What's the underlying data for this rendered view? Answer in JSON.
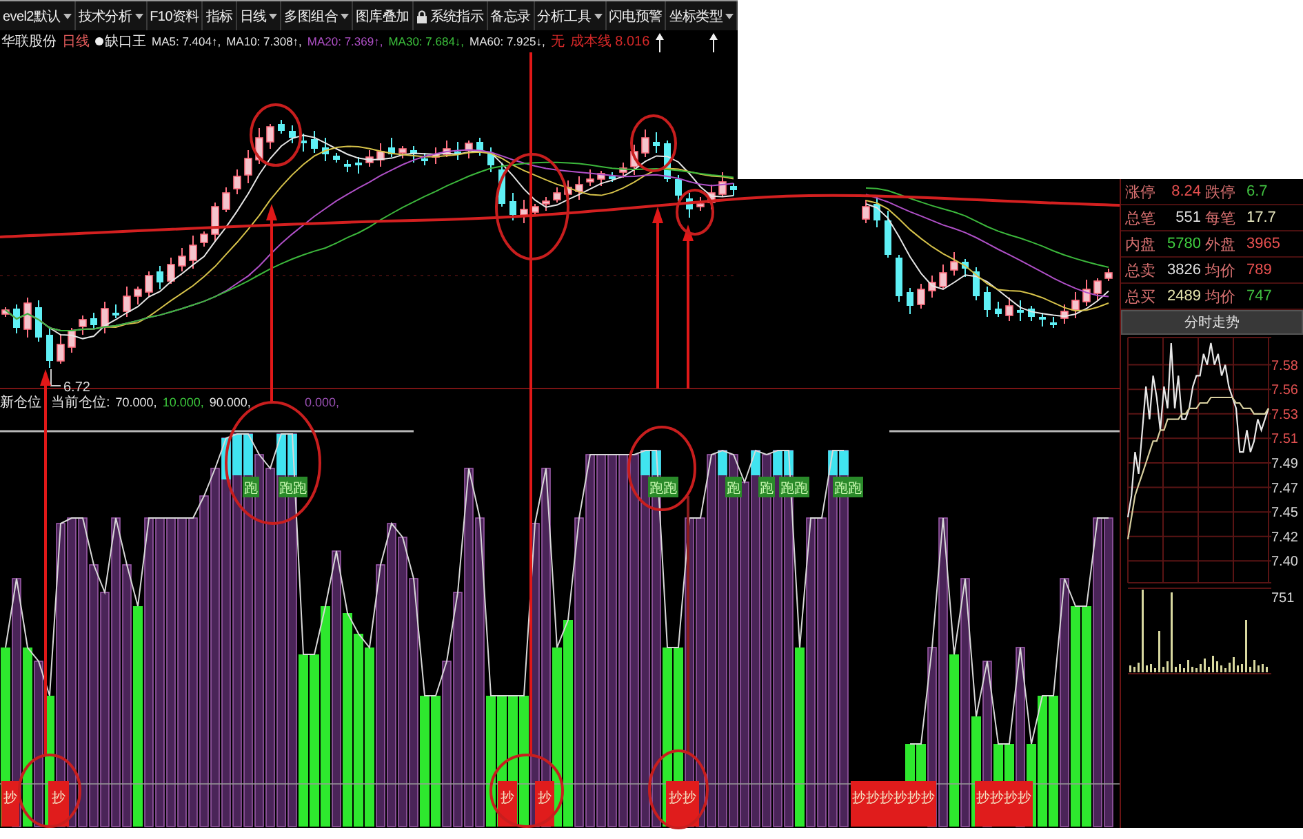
{
  "toolbar": {
    "items": [
      {
        "label": "evel2默认",
        "kind": "dropdown"
      },
      {
        "label": "技术分析",
        "kind": "dropdown"
      },
      {
        "label": "F10资料",
        "kind": "plain"
      },
      {
        "label": "指标",
        "kind": "plain"
      },
      {
        "label": "日线",
        "kind": "dropdown"
      },
      {
        "label": "多图组合",
        "kind": "dropdown"
      },
      {
        "label": "图库叠加",
        "kind": "plain"
      },
      {
        "label": "系统指示",
        "kind": "locked"
      },
      {
        "label": "备忘录",
        "kind": "plain"
      },
      {
        "label": "分析工具",
        "kind": "dropdown"
      },
      {
        "label": "闪电预警",
        "kind": "plain"
      },
      {
        "label": "坐标类型",
        "kind": "dropdown"
      }
    ]
  },
  "quote_line": {
    "stock": "华联股份",
    "period": "日线",
    "indicator": "缺口王",
    "values": [
      {
        "text": "MA5: 7.404↑,",
        "color": "#e6e6e6"
      },
      {
        "text": "MA10: 7.308↑,",
        "color": "#e6e6e6"
      },
      {
        "text": "MA20: 7.369↑,",
        "color": "#b050c8"
      },
      {
        "text": "MA30: 7.684↓,",
        "color": "#3cc03c"
      },
      {
        "text": "MA60: 7.925↓,",
        "color": "#e6e6e6"
      }
    ],
    "notes": [
      "无",
      "成本线 8.016"
    ]
  },
  "price_chart": {
    "low_label": "6.72"
  },
  "indicator": {
    "name": "新仓位",
    "label": "当前仓位:",
    "values": [
      {
        "text": "70.000,",
        "color": "#e6e6e6"
      },
      {
        "text": "10.000,",
        "color": "#3cc83c"
      },
      {
        "text": "90.000,",
        "color": "#e6e6e6"
      },
      {
        "text": "0.000,",
        "color": "#9a50b4"
      }
    ],
    "sell_tags": [
      "跑",
      "跑跑",
      "跑跑",
      "跑",
      "跑",
      "跑跑",
      "跑跑"
    ],
    "buy_tags": [
      "抄",
      "抄",
      "抄",
      "抄",
      "抄抄",
      "抄抄抄抄抄抄",
      "抄抄抄抄"
    ]
  },
  "quote_panel": {
    "rows": [
      {
        "label": "涨停",
        "value": {
          "text": "8.24",
          "color": "#e85050"
        },
        "label_2": "跌停",
        "value_2": {
          "text": "6.7",
          "color": "#40c040"
        }
      },
      {
        "label": "总笔",
        "value": {
          "text": "551",
          "color": "#e0e0e0"
        },
        "label_2": "每笔",
        "value_2": {
          "text": "17.7",
          "color": "#e8e8c0"
        }
      },
      {
        "label": "内盘",
        "value": {
          "text": "5780",
          "color": "#40d040"
        },
        "label_2": "外盘",
        "value_2": {
          "text": "3965",
          "color": "#e85050"
        }
      },
      {
        "label": "总卖",
        "value": {
          "text": "3826",
          "color": "#e0e0e0"
        },
        "label_2": "均价",
        "value_2": {
          "text": "789",
          "color": "#e85050"
        }
      },
      {
        "label": "总买",
        "value": {
          "text": "2489",
          "color": "#e8e8b0"
        },
        "label_2": "均价",
        "value_2": {
          "text": "747",
          "color": "#40c040"
        }
      }
    ],
    "title": "分时走势",
    "chart_data": {
      "type": "line",
      "grid": true,
      "ylim": [
        7.38,
        7.605
      ],
      "yticks": [
        {
          "value": 7.58,
          "label": "7.58"
        },
        {
          "value": 7.5575,
          "label": "7.56"
        },
        {
          "value": 7.535,
          "label": "7.53"
        },
        {
          "value": 7.5125,
          "label": "7.51"
        },
        {
          "value": 7.49,
          "label": "7.49"
        },
        {
          "value": 7.4675,
          "label": "7.47"
        },
        {
          "value": 7.445,
          "label": "7.45"
        },
        {
          "value": 7.4225,
          "label": "7.42"
        },
        {
          "value": 7.4,
          "label": "7.40"
        }
      ],
      "series": [
        {
          "color": "#e8e8e8",
          "values": [
            7.44,
            7.46,
            7.5,
            7.48,
            7.52,
            7.56,
            7.53,
            7.57,
            7.55,
            7.52,
            7.56,
            7.54,
            7.6,
            7.54,
            7.57,
            7.53,
            7.53,
            7.54,
            7.56,
            7.57,
            7.57,
            7.59,
            7.58,
            7.6,
            7.58,
            7.59,
            7.57,
            7.58,
            7.56,
            7.55,
            7.54,
            7.5,
            7.5,
            7.52,
            7.5,
            7.51,
            7.53,
            7.52,
            7.53,
            7.54
          ]
        },
        {
          "color": "#d8d0a0",
          "values": [
            7.42,
            7.44,
            7.46,
            7.47,
            7.48,
            7.49,
            7.5,
            7.51,
            7.51,
            7.52,
            7.52,
            7.53,
            7.53,
            7.53,
            7.53,
            7.535,
            7.535,
            7.54,
            7.54,
            7.54,
            7.545,
            7.545,
            7.545,
            7.55,
            7.55,
            7.55,
            7.55,
            7.55,
            7.55,
            7.55,
            7.545,
            7.545,
            7.54,
            7.54,
            7.54,
            7.535,
            7.535,
            7.535,
            7.535,
            7.54
          ]
        }
      ]
    },
    "volume_label": "751"
  }
}
